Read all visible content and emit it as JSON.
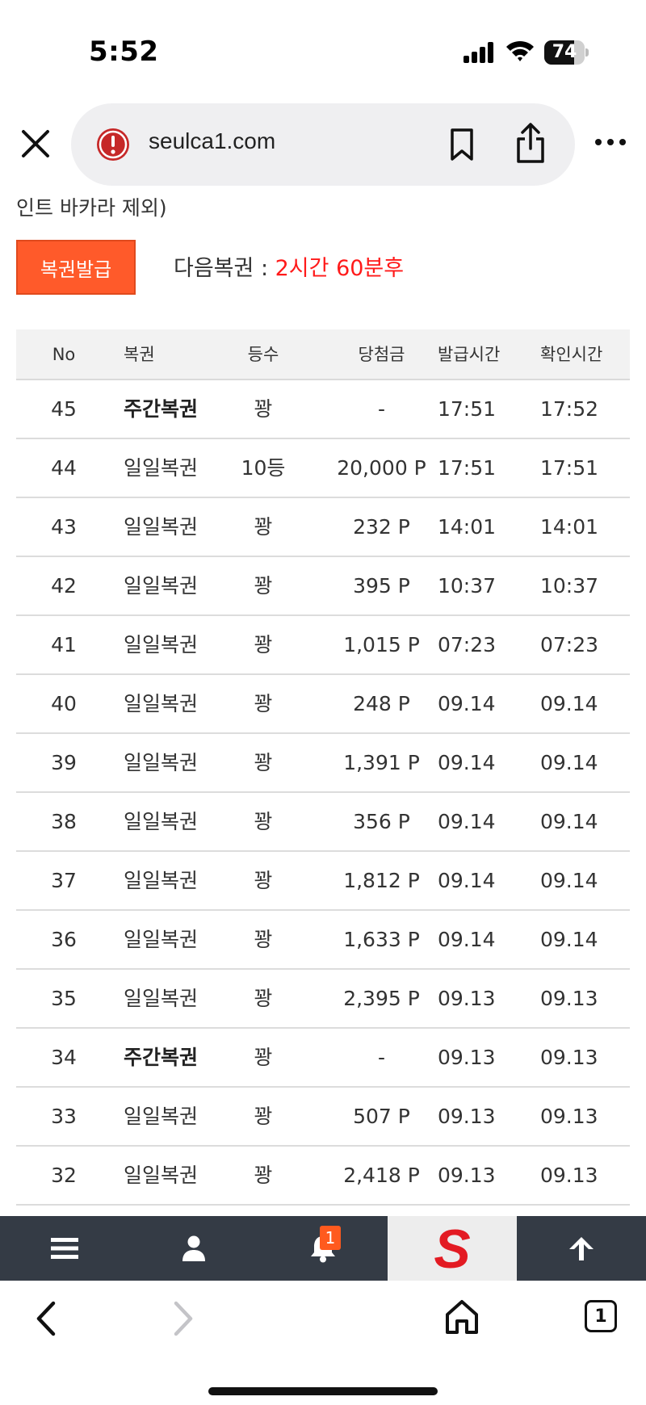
{
  "status_bar": {
    "time": "5:52",
    "battery": "74",
    "battery_level": 0.74
  },
  "browser": {
    "url": "seulca1.com",
    "icons": [
      "close-icon",
      "security-warning-icon",
      "bookmark-icon",
      "share-icon",
      "more-icon"
    ]
  },
  "page": {
    "truncated_text": "인트 바카라 제외)",
    "issue_button": "복권발급",
    "next_label": "다음복권 : ",
    "next_countdown": "2시간 60분후",
    "accent_color": "#ff5a2a",
    "countdown_color": "#ff1a1a"
  },
  "table": {
    "headers": {
      "no": "No",
      "type": "복권",
      "rank": "등수",
      "prize": "당첨금",
      "issued": "발급시간",
      "checked": "확인시간"
    },
    "rows": [
      {
        "no": "45",
        "type": "주간복권",
        "bold": true,
        "rank": "꽝",
        "prize": "-",
        "issued": "17:51",
        "checked": "17:52"
      },
      {
        "no": "44",
        "type": "일일복권",
        "bold": false,
        "rank": "10등",
        "prize": "20,000 P",
        "issued": "17:51",
        "checked": "17:51"
      },
      {
        "no": "43",
        "type": "일일복권",
        "bold": false,
        "rank": "꽝",
        "prize": "232 P",
        "issued": "14:01",
        "checked": "14:01"
      },
      {
        "no": "42",
        "type": "일일복권",
        "bold": false,
        "rank": "꽝",
        "prize": "395 P",
        "issued": "10:37",
        "checked": "10:37"
      },
      {
        "no": "41",
        "type": "일일복권",
        "bold": false,
        "rank": "꽝",
        "prize": "1,015 P",
        "issued": "07:23",
        "checked": "07:23"
      },
      {
        "no": "40",
        "type": "일일복권",
        "bold": false,
        "rank": "꽝",
        "prize": "248 P",
        "issued": "09.14",
        "checked": "09.14"
      },
      {
        "no": "39",
        "type": "일일복권",
        "bold": false,
        "rank": "꽝",
        "prize": "1,391 P",
        "issued": "09.14",
        "checked": "09.14"
      },
      {
        "no": "38",
        "type": "일일복권",
        "bold": false,
        "rank": "꽝",
        "prize": "356 P",
        "issued": "09.14",
        "checked": "09.14"
      },
      {
        "no": "37",
        "type": "일일복권",
        "bold": false,
        "rank": "꽝",
        "prize": "1,812 P",
        "issued": "09.14",
        "checked": "09.14"
      },
      {
        "no": "36",
        "type": "일일복권",
        "bold": false,
        "rank": "꽝",
        "prize": "1,633 P",
        "issued": "09.14",
        "checked": "09.14"
      },
      {
        "no": "35",
        "type": "일일복권",
        "bold": false,
        "rank": "꽝",
        "prize": "2,395 P",
        "issued": "09.13",
        "checked": "09.13"
      },
      {
        "no": "34",
        "type": "주간복권",
        "bold": true,
        "rank": "꽝",
        "prize": "-",
        "issued": "09.13",
        "checked": "09.13"
      },
      {
        "no": "33",
        "type": "일일복권",
        "bold": false,
        "rank": "꽝",
        "prize": "507 P",
        "issued": "09.13",
        "checked": "09.13"
      },
      {
        "no": "32",
        "type": "일일복권",
        "bold": false,
        "rank": "꽝",
        "prize": "2,418 P",
        "issued": "09.13",
        "checked": "09.13"
      }
    ]
  },
  "site_nav": {
    "items": [
      "menu-icon",
      "user-icon",
      "bell-icon",
      "site-logo-icon",
      "arrow-up-icon"
    ],
    "notification_count": "1",
    "logo_letter": "S",
    "bar_color": "#343b45"
  },
  "browser_bottom": {
    "icons": [
      "back-icon",
      "forward-icon",
      "home-icon",
      "tabs-icon"
    ],
    "tab_count": "1"
  }
}
